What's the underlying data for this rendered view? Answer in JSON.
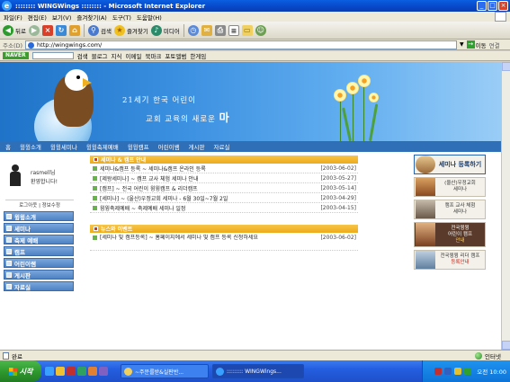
{
  "window": {
    "title": ":::::::: WINGWings :::::::: - Microsoft Internet Explorer",
    "controls": [
      "_",
      "□",
      "×"
    ]
  },
  "menubar": [
    "파일(F)",
    "편집(E)",
    "보기(V)",
    "즐겨찾기(A)",
    "도구(T)",
    "도움말(H)"
  ],
  "toolbar": {
    "back": "뒤로",
    "search": "검색",
    "favorites": "즐겨찾기",
    "media": "미디어"
  },
  "addressbar": {
    "label": "주소(D)",
    "url": "http://wingwings.com/",
    "go": "이동",
    "links": "연결"
  },
  "naverbar": {
    "logo": "NAVER",
    "items": [
      "검색",
      "블로그",
      "지식",
      "이메일",
      "북마크",
      "포토앨범",
      "한게임"
    ]
  },
  "banner": {
    "title": "21세기 한국 어린이",
    "subtitle_prefix": "교회 교육의 새로운",
    "subtitle_bold": "마"
  },
  "nav": [
    "홈",
    "윙윙소개",
    "윙윙세미나",
    "윙윙축제예배",
    "윙윙캠프",
    "어린이쌤",
    "게시판",
    "자료실"
  ],
  "login": {
    "user": "rasmell님",
    "greeting": "환영합니다!",
    "links": "로그아웃 | 정보수정"
  },
  "leftmenu": [
    "윙윙소개",
    "세미나",
    "축제 예배",
    "캠프",
    "어린이쌤",
    "게시판",
    "자료실"
  ],
  "notice": {
    "header": "세미나 & 캠프 안내",
    "rows": [
      {
        "title": "세미나&캠프 등록 ~ 세미나&캠프 온라인 등록",
        "date": "[2003-06-02]"
      },
      {
        "title": "[제왕세미나] ~ 캠프 교사 체험 세미나 안내",
        "date": "[2003-05-27]"
      },
      {
        "title": "[캠프] ~ 전국 어린이 윙윙캠프 & 리더캠프",
        "date": "[2003-05-14]"
      },
      {
        "title": "[세미나] ~ (울산)우정교회 세미나 - 6월 30일~7월 2일",
        "date": "[2003-04-29]"
      },
      {
        "title": "윙윙축제예배 ~ 축제예배 세미나 일정",
        "date": "[2003-04-15]"
      }
    ]
  },
  "news": {
    "header": "뉴스와 이벤트",
    "rows": [
      {
        "title": "[세미나 및 캠프등록] ~ 홈페이지에서 세미나 및 캠프 등록 신청하세요",
        "date": "[2003-06-02]"
      }
    ]
  },
  "rightcol": [
    {
      "line1": "세미나 등록하기",
      "line2": ""
    },
    {
      "line1": "(울산)우정교회",
      "line2": "세미나"
    },
    {
      "line1": "캠프 교사 체험",
      "line2": "세미나"
    },
    {
      "line1": "전국윙윙",
      "line2": "어린이 캠프",
      "line3": "안내"
    },
    {
      "line1": "전국윙윙 리더 캠프",
      "line2": "등록안내"
    }
  ],
  "status": {
    "left": "완료",
    "zone": "인터넷"
  },
  "taskbar": {
    "start": "시작",
    "tasks": [
      "~주문를받&실판반...",
      "::::::::: WINGWings..."
    ],
    "clock": "오전 10:00"
  }
}
